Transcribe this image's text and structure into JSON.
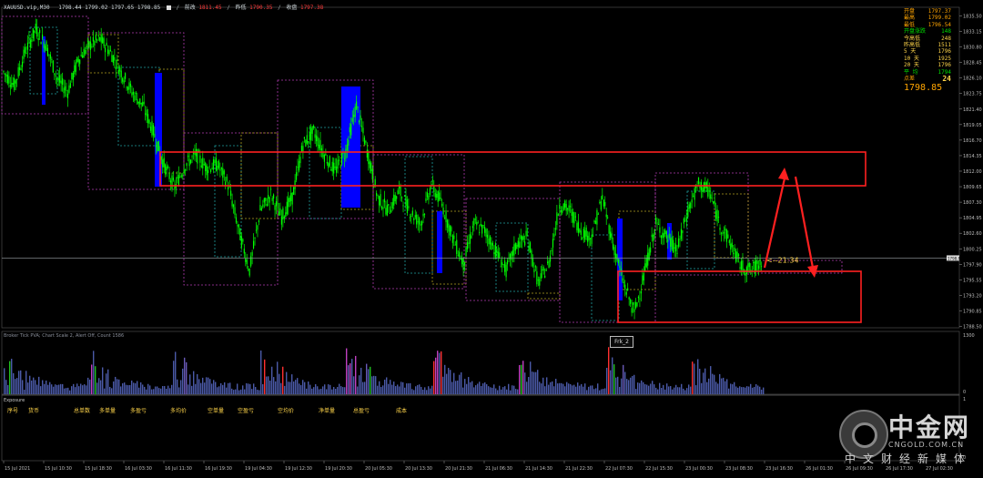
{
  "header": {
    "symbol": "XAUUSD.vip,M30",
    "ohlc": "1798.44 1799.02 1797.65 1798.85",
    "sep": "/",
    "open_label": "前改",
    "open_value": "1811.45",
    "low_label": "昨低",
    "low_value": "1790.35",
    "close_label": "收盘",
    "close_value": "1797.38"
  },
  "stats_panel": {
    "rows": [
      {
        "label": "开盘",
        "value": "1797.37",
        "color": "#ffa500"
      },
      {
        "label": "最高",
        "value": "1799.02",
        "color": "#ffa500"
      },
      {
        "label": "最低",
        "value": "1796.54",
        "color": "#ffa500"
      },
      {
        "label": "开盘涨跌",
        "value": "148",
        "color": "#00e000"
      },
      {
        "label": "今高低",
        "value": "248",
        "color": "#ffd54a"
      },
      {
        "label": "昨高低",
        "value": "1511",
        "color": "#ffd54a"
      },
      {
        "label": "5 天",
        "value": "1796",
        "color": "#ffd54a"
      },
      {
        "label": "10 天",
        "value": "1925",
        "color": "#ffd54a"
      },
      {
        "label": "20 天",
        "value": "1796",
        "color": "#ffd54a"
      },
      {
        "label": "平 均",
        "value": "1794",
        "color": "#00e000"
      }
    ],
    "count_label": "点差",
    "count_value": "24",
    "current_price": "1798.85"
  },
  "countdown": "<--21:34",
  "indicator_label": "Broker Tick PVA;  Chart Scale 2, Alert Off, Count 1586",
  "indicator_scale": {
    "top": "1300",
    "bottom": "0"
  },
  "frk_button": "Frk_2",
  "exposure": {
    "title": "Exposure",
    "scale": {
      "top": "1",
      "bottom": "0"
    },
    "columns": [
      "序号",
      "货币",
      "总单数",
      "多单量",
      "多盈亏",
      "多均价",
      "空单量",
      "空盈亏",
      "空均价",
      "净单量",
      "总盈亏",
      "成本"
    ]
  },
  "watermark": {
    "name": "中金网",
    "domain": "CNGOLD.COM.CN",
    "subtitle": "中文财经新媒体"
  },
  "colors": {
    "candle": "#00ff00",
    "volume_bar": "#4b5aa8",
    "annotation": "#ff2020",
    "price_line": "#9aa0a6",
    "box_magenta": "#b03ab0",
    "box_yellow": "#b0a020",
    "box_cyan": "#20a0a0",
    "blue_bar": "#0000ff"
  },
  "chart_data": {
    "type": "line",
    "ylim": [
      1788.3,
      1836.8
    ],
    "y_ticks": [
      "1835.50",
      "1833.15",
      "1830.80",
      "1828.45",
      "1826.10",
      "1823.75",
      "1821.40",
      "1819.05",
      "1816.70",
      "1814.35",
      "1812.00",
      "1809.65",
      "1807.30",
      "1804.95",
      "1802.60",
      "1800.25",
      "1797.90",
      "1795.55",
      "1793.20",
      "1790.85",
      "1788.50"
    ],
    "current_price": 1798.85,
    "x_ticks": [
      "15 Jul 2021",
      "15 Jul 10:30",
      "15 Jul 18:30",
      "16 Jul 03:30",
      "16 Jul 11:30",
      "16 Jul 19:30",
      "19 Jul 04:30",
      "19 Jul 12:30",
      "19 Jul 20:30",
      "20 Jul 05:30",
      "20 Jul 13:30",
      "20 Jul 21:30",
      "21 Jul 06:30",
      "21 Jul 14:30",
      "21 Jul 22:30",
      "22 Jul 07:30",
      "22 Jul 15:30",
      "23 Jul 00:30",
      "23 Jul 08:30",
      "23 Jul 16:30",
      "26 Jul 01:30",
      "26 Jul 09:30",
      "26 Jul 17:30",
      "27 Jul 02:30"
    ],
    "price_path": [
      1827,
      1825,
      1830,
      1833.5,
      1831,
      1826,
      1824,
      1829,
      1831,
      1832,
      1830,
      1827,
      1824,
      1822,
      1818,
      1813,
      1809.5,
      1813,
      1814.5,
      1812.5,
      1813,
      1810,
      1803,
      1797,
      1806,
      1808.5,
      1805,
      1808,
      1816,
      1818,
      1814.5,
      1812,
      1815,
      1822,
      1815,
      1808,
      1806,
      1809,
      1806,
      1804,
      1810,
      1807,
      1802,
      1798,
      1804,
      1803,
      1800,
      1797,
      1801,
      1802,
      1795,
      1798,
      1807,
      1806,
      1803,
      1802,
      1808,
      1801,
      1795,
      1790.5,
      1797,
      1804,
      1802,
      1800,
      1806,
      1810,
      1809,
      1804,
      1801,
      1797.5,
      1797,
      1798.85
    ]
  }
}
